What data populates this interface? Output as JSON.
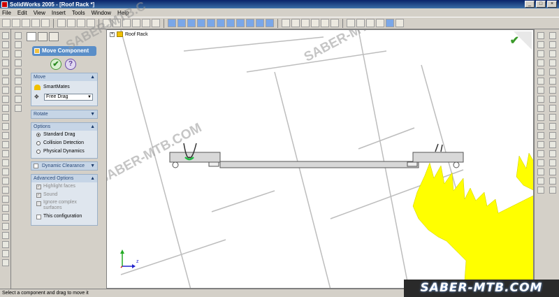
{
  "window": {
    "title": "SolidWorks 2005 - [Roof Rack *]",
    "minimize": "_",
    "maximize": "□",
    "close": "×"
  },
  "menu": [
    "File",
    "Edit",
    "View",
    "Insert",
    "Tools",
    "Window",
    "Help"
  ],
  "property_manager": {
    "title": "Move Component",
    "ok_glyph": "✔",
    "help_glyph": "?",
    "move": {
      "header": "Move",
      "smartmates_label": "SmartMates",
      "drag_mode": "Free Drag"
    },
    "rotate": {
      "header": "Rotate"
    },
    "options": {
      "header": "Options",
      "items": [
        {
          "label": "Standard Drag",
          "selected": true
        },
        {
          "label": "Collision Detection",
          "selected": false
        },
        {
          "label": "Physical Dynamics",
          "selected": false
        }
      ]
    },
    "dynamic_clearance": {
      "label": "Dynamic Clearance"
    },
    "advanced": {
      "header": "Advanced Options",
      "highlight_faces": "Highlight faces",
      "sound": "Sound",
      "ignore_complex_line1": "Ignore complex",
      "ignore_complex_line2": "surfaces",
      "this_configuration": "This configuration"
    }
  },
  "viewport": {
    "tree_label": "Roof Rack",
    "expand_sign": "+",
    "triad_z": "z",
    "confirm_glyph": "✔"
  },
  "watermarks": {
    "text": "SABER-MTB.COM",
    "fragment": "SABER-MTB.C"
  },
  "brand_banner": "SABER-MTB.COM",
  "status_text": "Select a component and drag to move it",
  "colors": {
    "logo_yellow": "#ffff00",
    "header_blue": "#5a8ec8",
    "mate_green": "#22bb44"
  }
}
